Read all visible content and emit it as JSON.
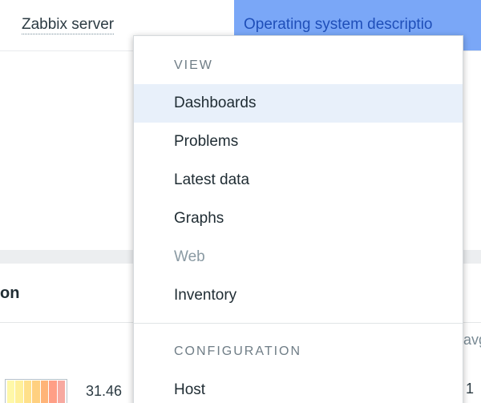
{
  "table": {
    "host_name": "Zabbix server",
    "highlighted_cell_text": "Operating system descriptio"
  },
  "widget": {
    "title_fragment": "on",
    "right_header_fragment": "avg",
    "gauge_value": "31.46",
    "right_value_fragment": "1",
    "gauge_colors": [
      "#fff8a8",
      "#fff09a",
      "#ffe08a",
      "#ffd080",
      "#ffb478",
      "#ff9f86",
      "#f7a9a0"
    ]
  },
  "context_menu": {
    "view_section_title": "VIEW",
    "items": [
      {
        "label": "Dashboards",
        "state": "active"
      },
      {
        "label": "Problems",
        "state": "normal"
      },
      {
        "label": "Latest data",
        "state": "normal"
      },
      {
        "label": "Graphs",
        "state": "normal"
      },
      {
        "label": "Web",
        "state": "disabled"
      },
      {
        "label": "Inventory",
        "state": "normal"
      }
    ],
    "configuration_section_title": "CONFIGURATION",
    "configuration_items": [
      {
        "label": "Host",
        "state": "normal"
      }
    ]
  },
  "colors": {
    "highlight_cell": "#7aa7f7",
    "highlight_text": "#1f4fb9",
    "menu_active": "#e8f0fa",
    "separator": "#eceef0"
  }
}
